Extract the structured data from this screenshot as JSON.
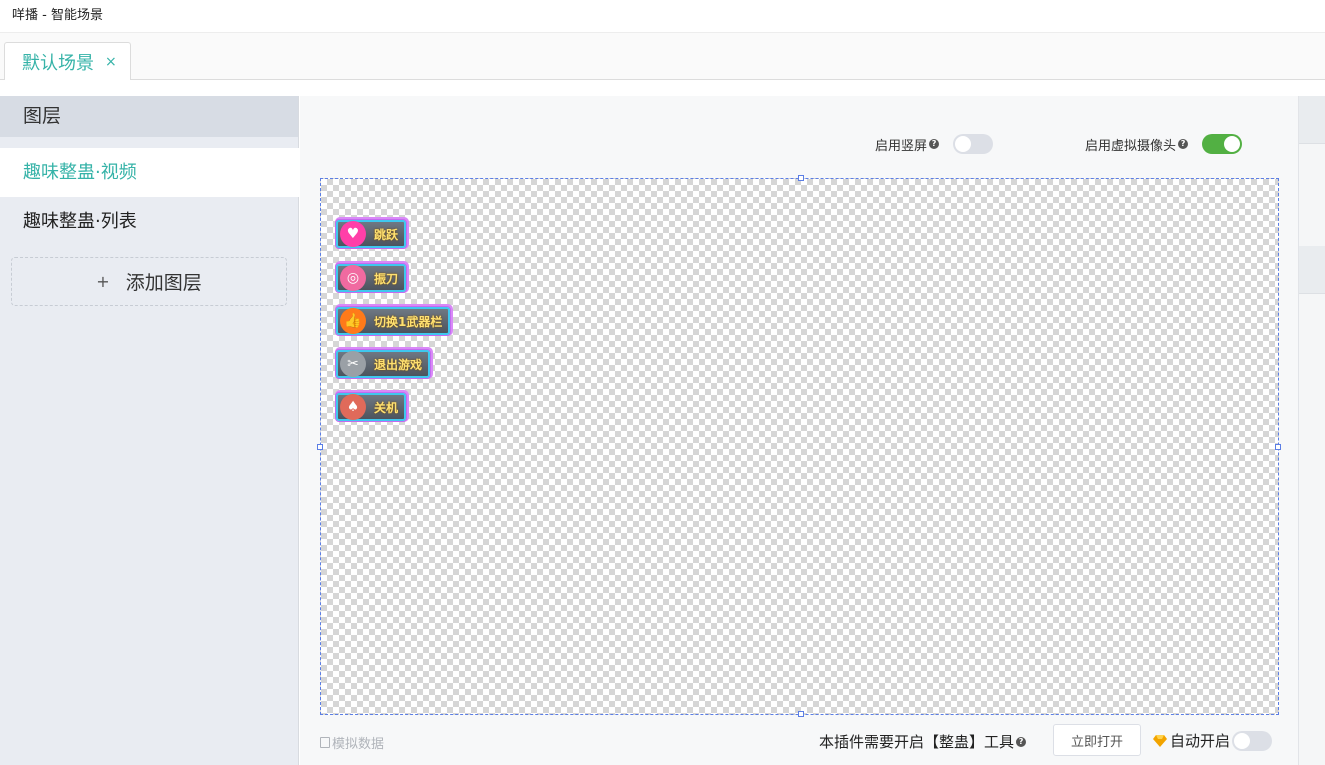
{
  "window": {
    "title": "咩播 - 智能场景"
  },
  "tabs": [
    {
      "label": "默认场景",
      "close": "×"
    }
  ],
  "sidebar": {
    "header": "图层",
    "items": [
      {
        "label": "趣味整蛊·视频",
        "active": true
      },
      {
        "label": "趣味整蛊·列表",
        "active": false
      }
    ],
    "add_layer": {
      "plus": "+",
      "label": "添加图层"
    }
  },
  "toolbar": {
    "vertical_screen": {
      "label": "启用竖屏",
      "help": "?",
      "enabled": false
    },
    "virtual_camera": {
      "label": "启用虚拟摄像头",
      "help": "?",
      "enabled": true
    }
  },
  "canvas": {
    "buttons": [
      {
        "label": "跳跃",
        "icon": "heart-icon",
        "icon_glyph": "♥",
        "icon_color": "#ff3fa8"
      },
      {
        "label": "振刀",
        "icon": "lollipop-icon",
        "icon_glyph": "◎",
        "icon_color": "#f06aa0"
      },
      {
        "label": "切换1武器栏",
        "icon": "thumbs-up-icon",
        "icon_glyph": "👍",
        "icon_color": "#ff7a1a"
      },
      {
        "label": "退出游戏",
        "icon": "scissors-icon",
        "icon_glyph": "✂",
        "icon_color": "#9aa0a6"
      },
      {
        "label": "关机",
        "icon": "mushroom-icon",
        "icon_glyph": "♠",
        "icon_color": "#e06a5a"
      }
    ]
  },
  "footer": {
    "mock_data": "模拟数据",
    "plugin_note": "本插件需要开启【整蛊】工具",
    "plugin_help": "?",
    "open_now": "立即打开",
    "auto_open": {
      "label": "自动开启",
      "enabled": false
    }
  },
  "colors": {
    "accent": "#36b3a8",
    "switch_on": "#52b043",
    "selection": "#5b7ee5"
  }
}
